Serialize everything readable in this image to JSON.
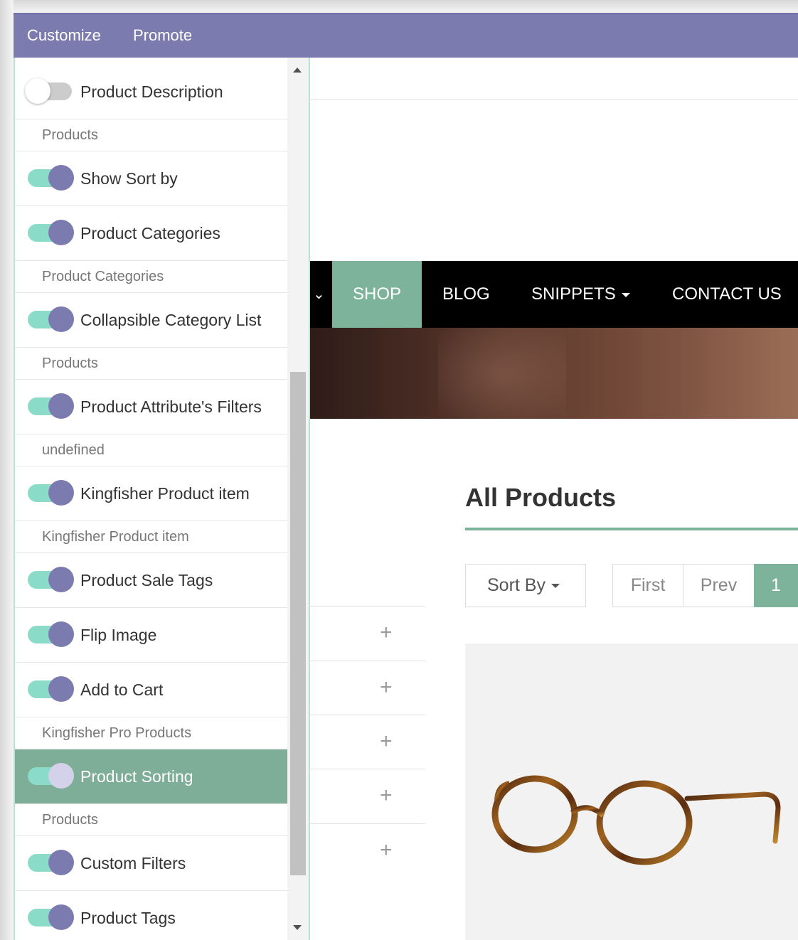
{
  "topbar": {
    "customize": "Customize",
    "promote": "Promote"
  },
  "panel": {
    "rows": [
      {
        "type": "opt",
        "label": "Product Description",
        "on": false
      },
      {
        "type": "cat",
        "label": "Products"
      },
      {
        "type": "opt",
        "label": "Show Sort by",
        "on": true
      },
      {
        "type": "opt",
        "label": "Product Categories",
        "on": true
      },
      {
        "type": "cat",
        "label": "Product Categories"
      },
      {
        "type": "opt",
        "label": "Collapsible Category List",
        "on": true
      },
      {
        "type": "cat",
        "label": "Products"
      },
      {
        "type": "opt",
        "label": "Product Attribute's Filters",
        "on": true
      },
      {
        "type": "cat",
        "label": "undefined"
      },
      {
        "type": "opt",
        "label": "Kingfisher Product item",
        "on": true
      },
      {
        "type": "cat",
        "label": "Kingfisher Product item"
      },
      {
        "type": "opt",
        "label": "Product Sale Tags",
        "on": true
      },
      {
        "type": "opt",
        "label": "Flip Image",
        "on": true
      },
      {
        "type": "opt",
        "label": "Add to Cart",
        "on": true
      },
      {
        "type": "cat",
        "label": "Kingfisher Pro Products"
      },
      {
        "type": "opt",
        "label": "Product Sorting",
        "on": true,
        "highlighted": true
      },
      {
        "type": "cat",
        "label": "Products"
      },
      {
        "type": "opt",
        "label": "Custom Filters",
        "on": true
      },
      {
        "type": "opt",
        "label": "Product Tags",
        "on": true
      }
    ]
  },
  "nav": {
    "shop": "SHOP",
    "blog": "BLOG",
    "snippets": "SNIPPETS",
    "contact": "CONTACT US"
  },
  "shop": {
    "title": "All Products",
    "sort_label": "Sort By",
    "pager": {
      "first": "First",
      "prev": "Prev",
      "current": "1"
    },
    "filter_plus": [
      "+",
      "+",
      "+",
      "+",
      "+"
    ]
  },
  "colors": {
    "topbar": "#7b7bb0",
    "accent_green": "#7db39b",
    "toggle_track": "#8adbc7",
    "toggle_knob": "#7b7bb0"
  }
}
